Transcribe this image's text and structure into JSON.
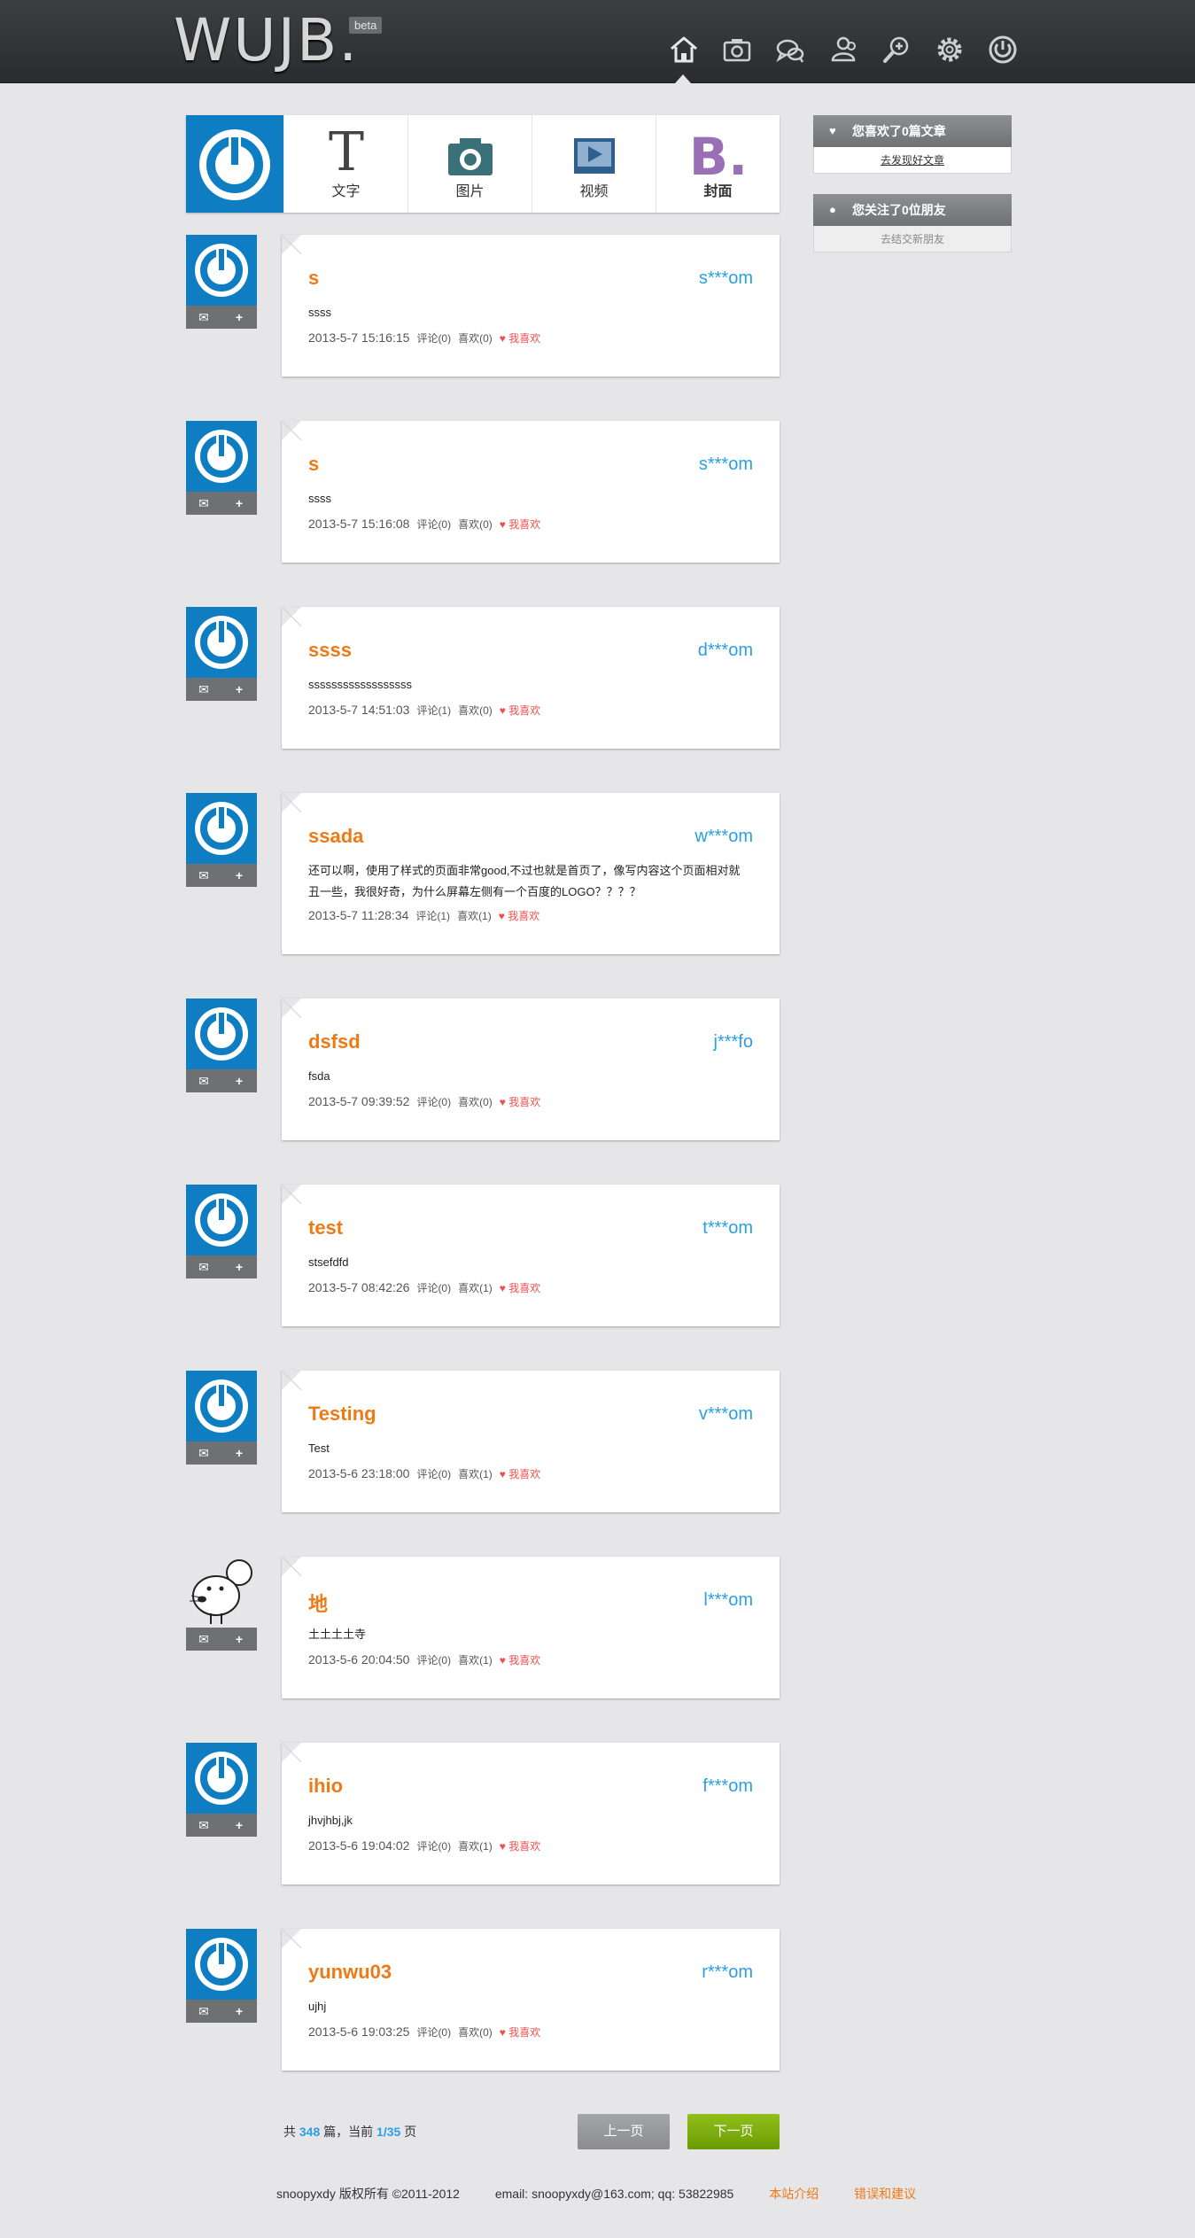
{
  "header": {
    "logo": "WUJB.",
    "badge": "beta",
    "nav_icons": [
      "home-icon",
      "camera-icon",
      "chat-icon",
      "users-icon",
      "search-icon",
      "settings-icon",
      "power-icon"
    ]
  },
  "composer": {
    "tools": [
      {
        "label": "文字",
        "icon": "text-icon"
      },
      {
        "label": "图片",
        "icon": "camera-icon"
      },
      {
        "label": "视频",
        "icon": "video-icon"
      },
      {
        "label": "封面",
        "icon": "cover-icon"
      }
    ]
  },
  "sidebar": {
    "likes": {
      "title": "您喜欢了0篇文章",
      "link": "去发现好文章"
    },
    "follows": {
      "title": "您关注了0位朋友",
      "link": "去结交新朋友"
    }
  },
  "posts": [
    {
      "title": "s",
      "author": "s***om",
      "body": "ssss",
      "date": "2013-5-7 15:16:15",
      "comments": "评论(0)",
      "likes": "喜欢(0)",
      "like_label": "我喜欢"
    },
    {
      "title": "s",
      "author": "s***om",
      "body": "ssss",
      "date": "2013-5-7 15:16:08",
      "comments": "评论(0)",
      "likes": "喜欢(0)",
      "like_label": "我喜欢"
    },
    {
      "title": "ssss",
      "author": "d***om",
      "body": "ssssssssssssssssss",
      "date": "2013-5-7 14:51:03",
      "comments": "评论(1)",
      "likes": "喜欢(0)",
      "like_label": "我喜欢"
    },
    {
      "title": "ssada",
      "author": "w***om",
      "body": "还可以啊，使用了样式的页面非常good,不过也就是首页了，像写内容这个页面相对就丑一些，我很好奇，为什么屏幕左侧有一个百度的LOGO？？？？",
      "date": "2013-5-7 11:28:34",
      "comments": "评论(1)",
      "likes": "喜欢(1)",
      "like_label": "我喜欢"
    },
    {
      "title": "dsfsd",
      "author": "j***fo",
      "body": "fsda",
      "date": "2013-5-7 09:39:52",
      "comments": "评论(0)",
      "likes": "喜欢(0)",
      "like_label": "我喜欢"
    },
    {
      "title": "test",
      "author": "t***om",
      "body": "stsefdfd",
      "date": "2013-5-7 08:42:26",
      "comments": "评论(0)",
      "likes": "喜欢(1)",
      "like_label": "我喜欢"
    },
    {
      "title": "Testing",
      "author": "v***om",
      "body": "Test",
      "date": "2013-5-6 23:18:00",
      "comments": "评论(0)",
      "likes": "喜欢(1)",
      "like_label": "我喜欢"
    },
    {
      "title": "地",
      "author": "l***om",
      "body": "土土土土寺",
      "date": "2013-5-6 20:04:50",
      "comments": "评论(0)",
      "likes": "喜欢(1)",
      "like_label": "我喜欢"
    },
    {
      "title": "ihio",
      "author": "f***om",
      "body": "jhvjhbj,jk",
      "date": "2013-5-6 19:04:02",
      "comments": "评论(0)",
      "likes": "喜欢(1)",
      "like_label": "我喜欢"
    },
    {
      "title": "yunwu03",
      "author": "r***om",
      "body": "ujhj",
      "date": "2013-5-6 19:03:25",
      "comments": "评论(0)",
      "likes": "喜欢(0)",
      "like_label": "我喜欢"
    }
  ],
  "pager": {
    "prefix": "共",
    "total": "348",
    "mid": "篇，当前",
    "page": "1/35",
    "suffix": "页",
    "prev": "上一页",
    "next": "下一页"
  },
  "footer": {
    "copyright": "snoopyxdy 版权所有 ©2011-2012",
    "contact": "email: snoopyxdy@163.com; qq: 53822985",
    "about": "本站介绍",
    "feedback": "错误和建议"
  }
}
